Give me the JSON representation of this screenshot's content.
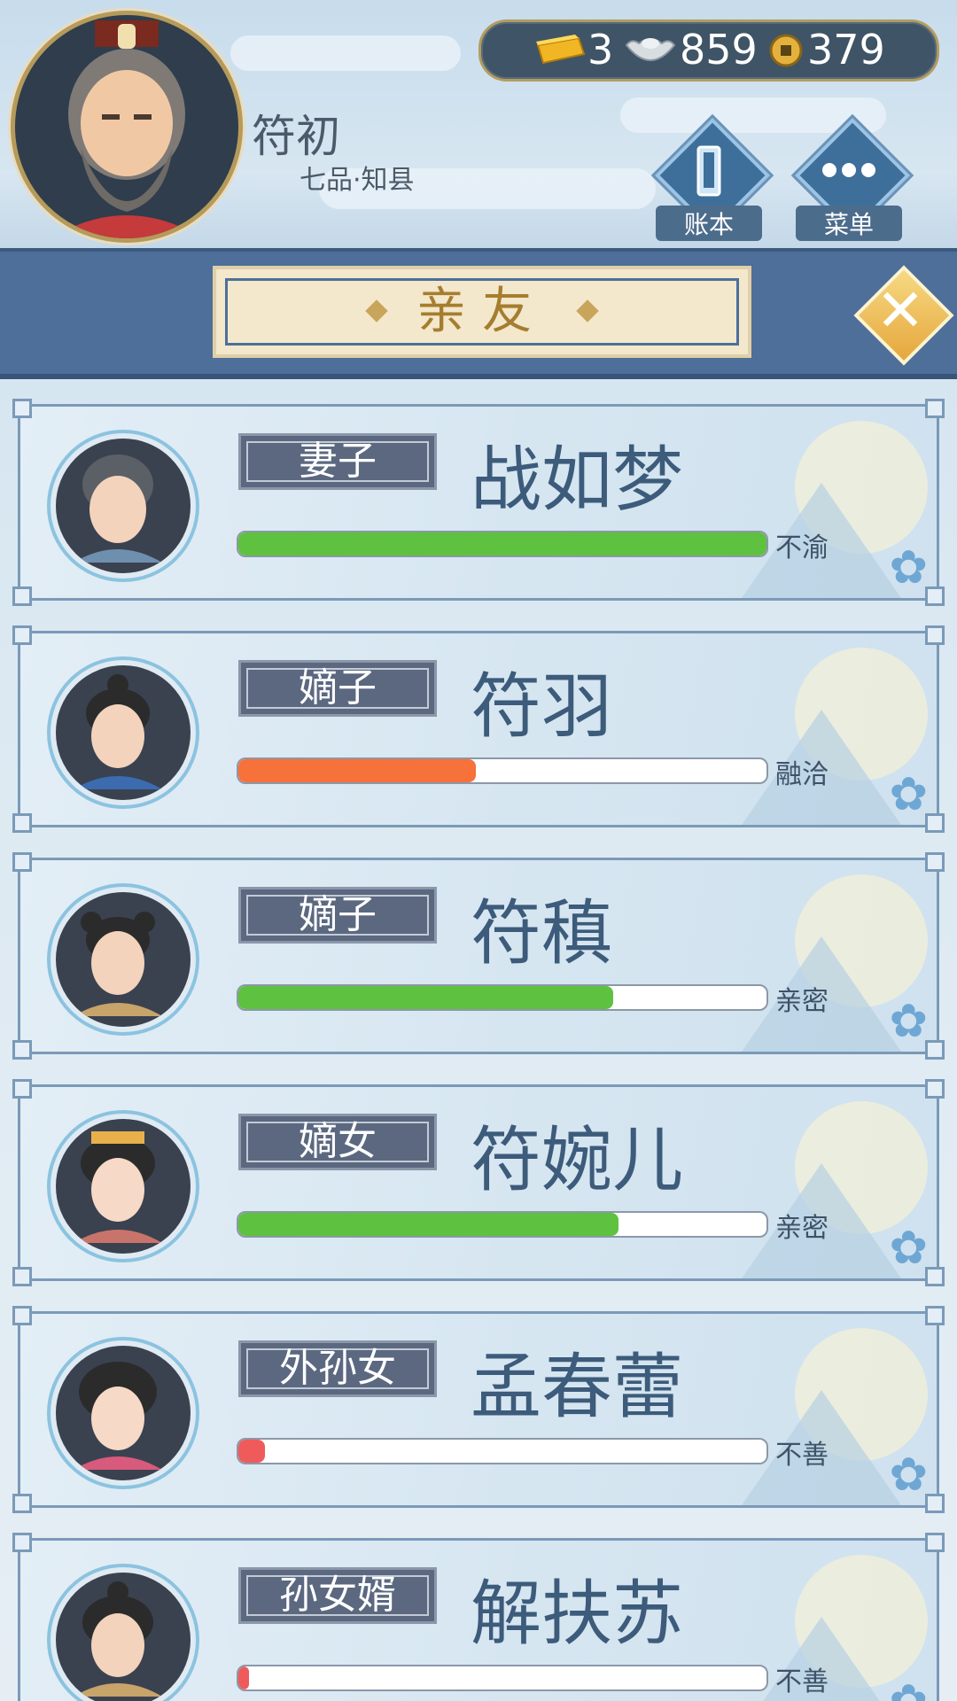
{
  "player": {
    "name": "符初",
    "rank": "七品·知县"
  },
  "resources": {
    "gold": "3",
    "silver": "859",
    "coins": "379"
  },
  "buttons": {
    "ledger": "账本",
    "menu": "菜单"
  },
  "title": "亲友",
  "relatives": [
    {
      "role": "妻子",
      "name": "战如梦",
      "status": "不渝",
      "affinity": 1.0,
      "bar_color": "#5ec13f"
    },
    {
      "role": "嫡子",
      "name": "符羽",
      "status": "融洽",
      "affinity": 0.45,
      "bar_color": "#f7713a"
    },
    {
      "role": "嫡子",
      "name": "符稹",
      "status": "亲密",
      "affinity": 0.71,
      "bar_color": "#5ec13f"
    },
    {
      "role": "嫡女",
      "name": "符婉儿",
      "status": "亲密",
      "affinity": 0.72,
      "bar_color": "#5ec13f"
    },
    {
      "role": "外孙女",
      "name": "孟春蕾",
      "status": "不善",
      "affinity": 0.05,
      "bar_color": "#ef5b5b"
    },
    {
      "role": "孙女婿",
      "name": "解扶苏",
      "status": "不善",
      "affinity": 0.01,
      "bar_color": "#ef5b5b"
    }
  ]
}
